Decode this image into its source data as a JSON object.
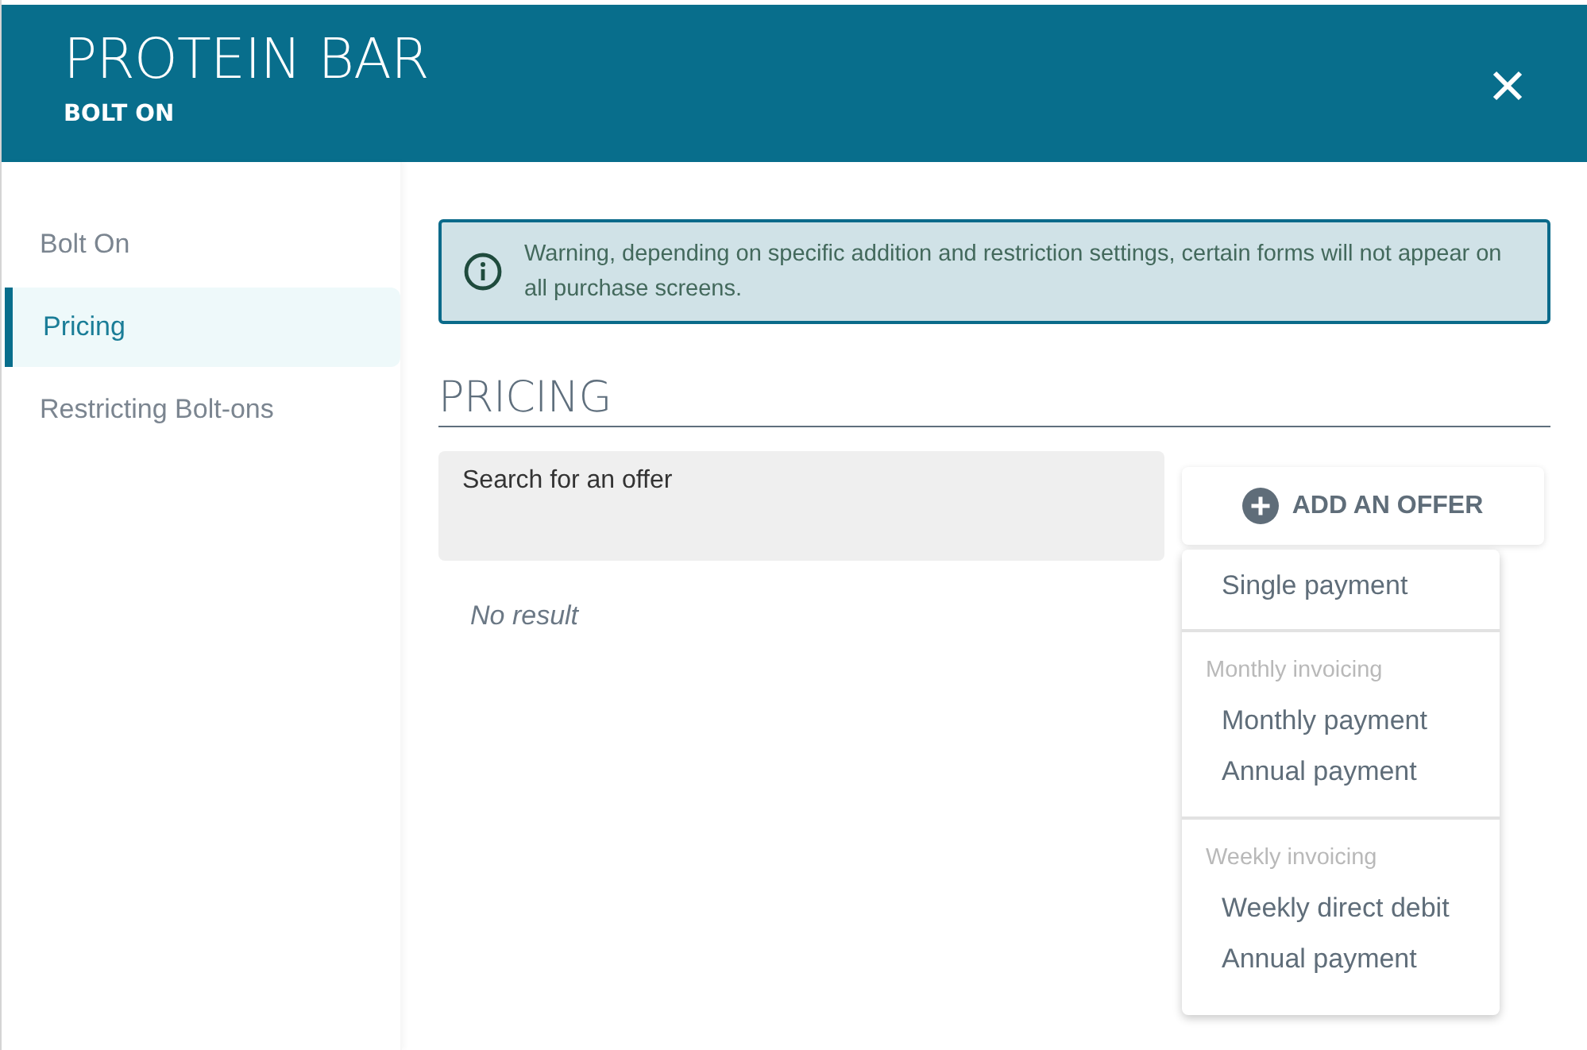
{
  "header": {
    "title": "PROTEIN BAR",
    "subtitle": "BOLT ON"
  },
  "sidebar": {
    "items": [
      {
        "label": "Bolt On",
        "selected": false
      },
      {
        "label": "Pricing",
        "selected": true
      },
      {
        "label": "Restricting Bolt-ons",
        "selected": false
      }
    ]
  },
  "warning": {
    "text": "Warning, depending on specific addition and restriction settings, certain forms will not appear on all purchase screens."
  },
  "section": {
    "title": "PRICING"
  },
  "search": {
    "placeholder": "Search for an offer"
  },
  "empty_message": "No result",
  "add_button": {
    "label": "ADD AN OFFER"
  },
  "offer_menu": {
    "groups": [
      {
        "items": [
          "Single payment"
        ]
      },
      {
        "heading": "Monthly invoicing",
        "items": [
          "Monthly payment",
          "Annual payment"
        ]
      },
      {
        "heading": "Weekly invoicing",
        "items": [
          "Weekly direct debit",
          "Annual payment"
        ]
      }
    ]
  }
}
